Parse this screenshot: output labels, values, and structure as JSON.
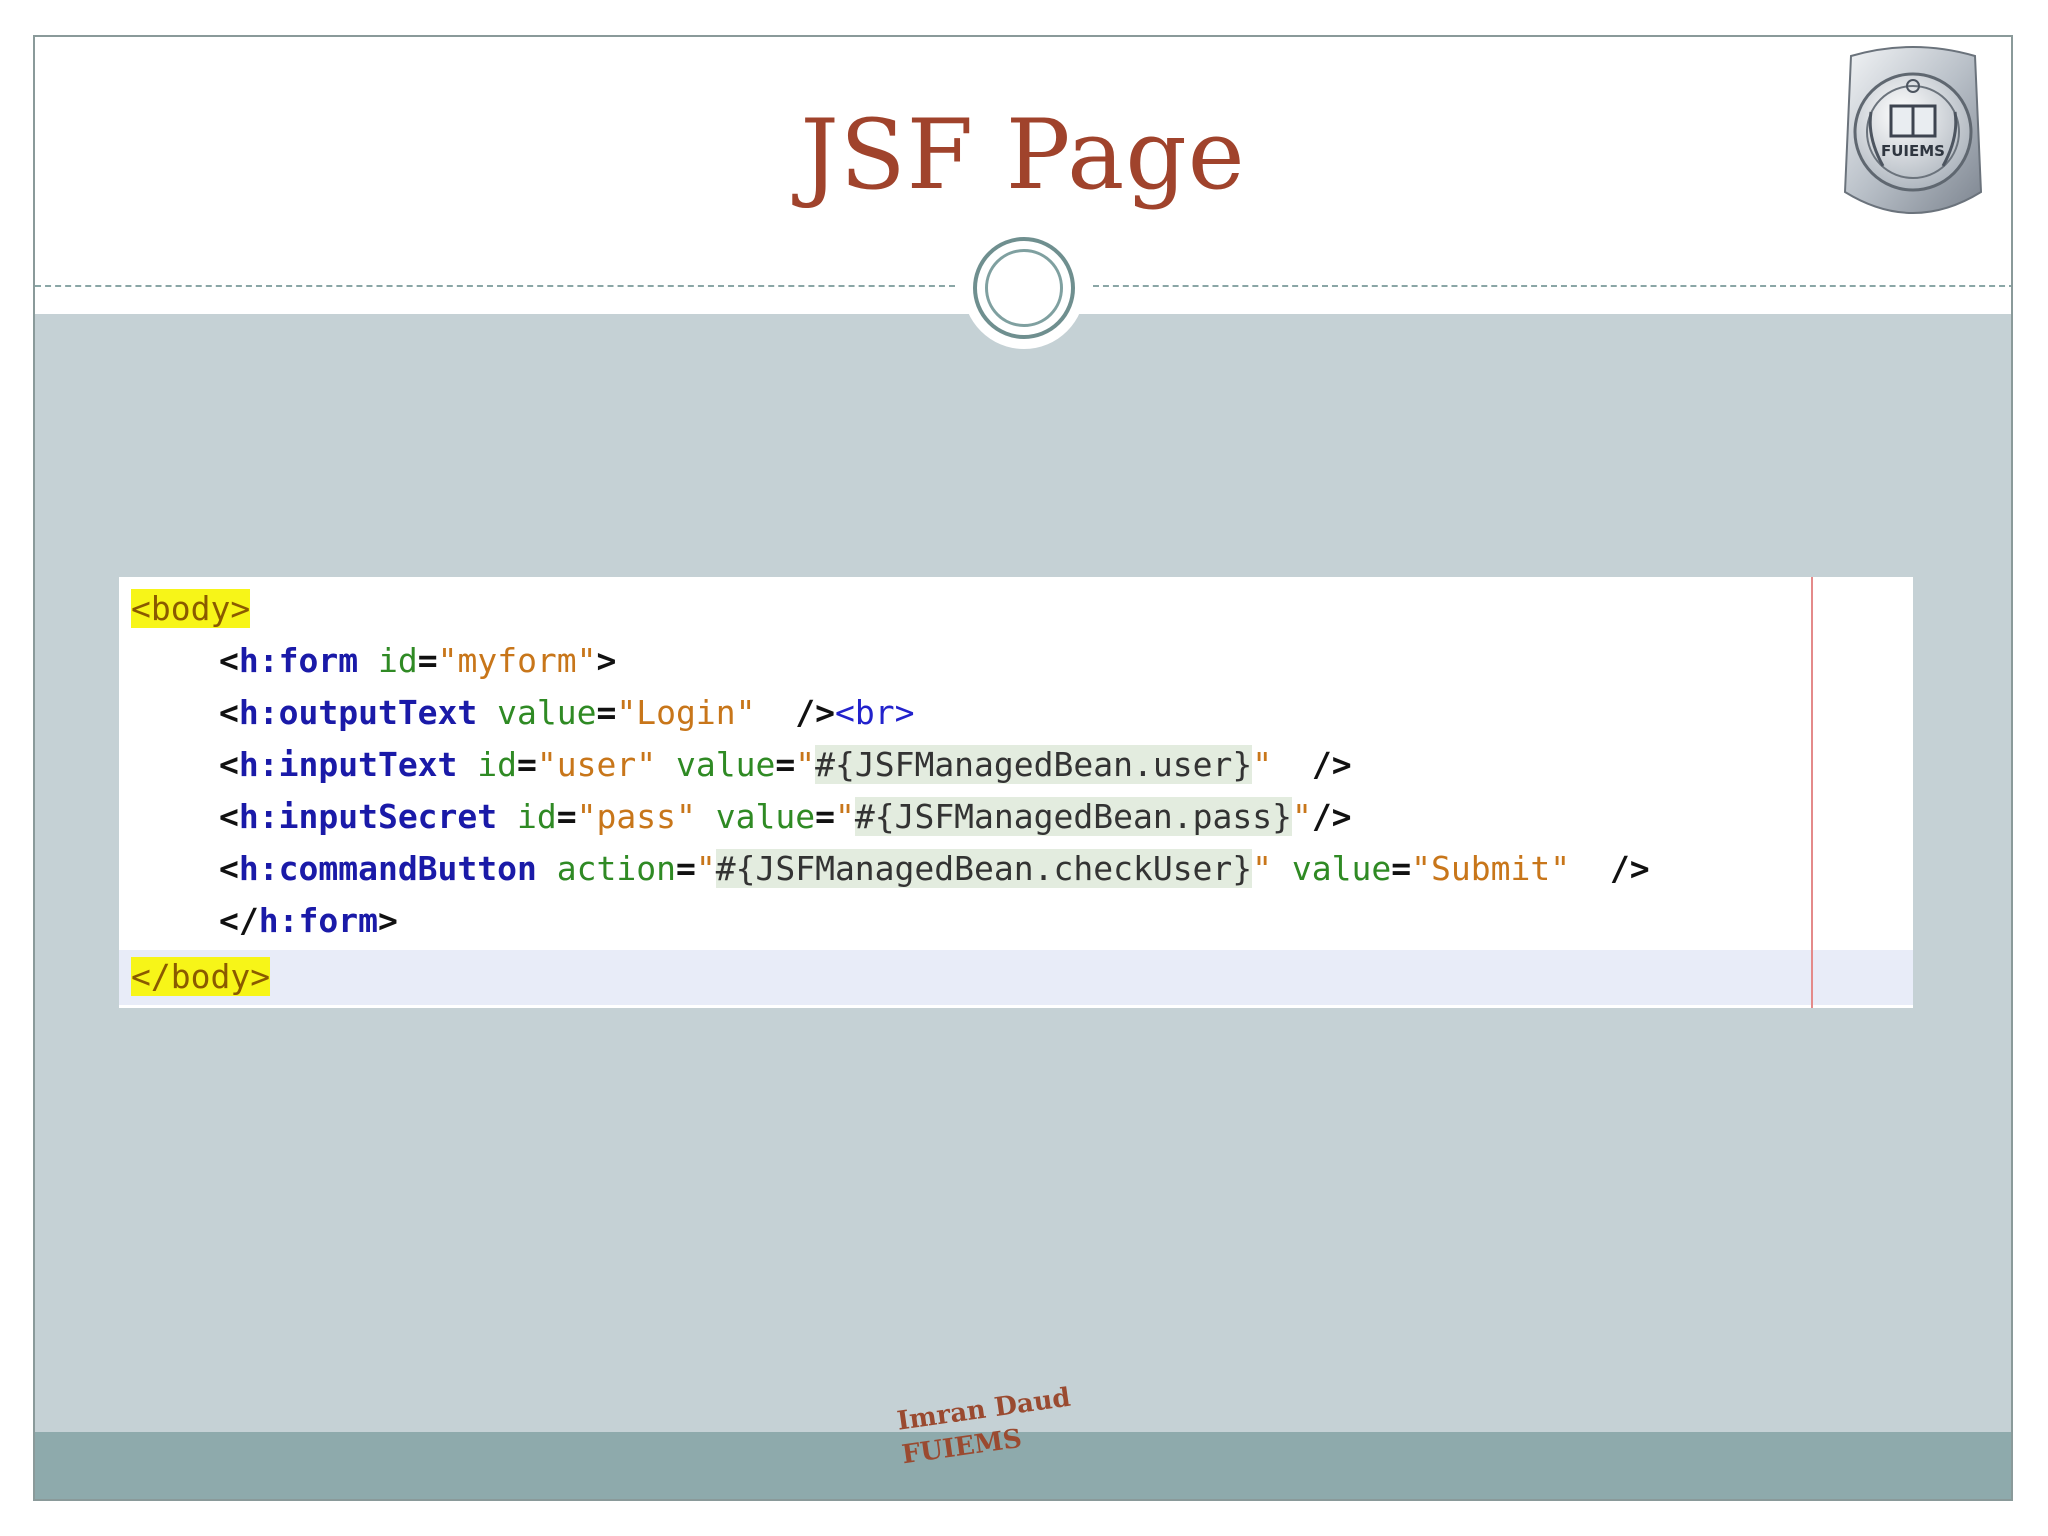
{
  "slide": {
    "title": "JSF Page",
    "logo_text": "FUIEMS"
  },
  "code": {
    "line1": "<body>",
    "line2": {
      "open": "<",
      "tag": "h:form",
      "attr1": "id",
      "eq1": "=",
      "val1": "\"myform\"",
      "close": ">"
    },
    "line3": {
      "open": "<",
      "tag": "h:outputText",
      "attr1": "value",
      "eq1": "=",
      "val1": "\"Login\"",
      "selfclose": "/>",
      "br": "<br>"
    },
    "line4": {
      "open": "<",
      "tag": "h:inputText",
      "attr1": "id",
      "eq1": "=",
      "val1": "\"user\"",
      "attr2": "value",
      "eq2": "=",
      "q_open": "\"",
      "el": "#{JSFManagedBean.user}",
      "q_close": "\"",
      "selfclose": "/>"
    },
    "line5": {
      "open": "<",
      "tag": "h:inputSecret",
      "attr1": "id",
      "eq1": "=",
      "val1": "\"pass\"",
      "attr2": "value",
      "eq2": "=",
      "q_open": "\"",
      "el": "#{JSFManagedBean.pass}",
      "q_close": "\"",
      "selfclose": "/>"
    },
    "line6": {
      "open": "<",
      "tag": "h:commandButton",
      "attr1": "action",
      "eq1": "=",
      "q_open": "\"",
      "el": "#{JSFManagedBean.checkUser}",
      "q_close": "\"",
      "attr2": "value",
      "eq2": "=",
      "val2": "\"Submit\"",
      "selfclose": "/>"
    },
    "line7": {
      "open": "</",
      "tag": "h:form",
      "close": ">"
    },
    "line8": "</body>"
  },
  "footer": {
    "author": "Imran Daud",
    "org": "FUIEMS"
  },
  "colors": {
    "title": "#a0432c",
    "slide_bg": "#c5d1d5",
    "footer_bg": "#8eaaac",
    "highlight": "#f7f518"
  }
}
